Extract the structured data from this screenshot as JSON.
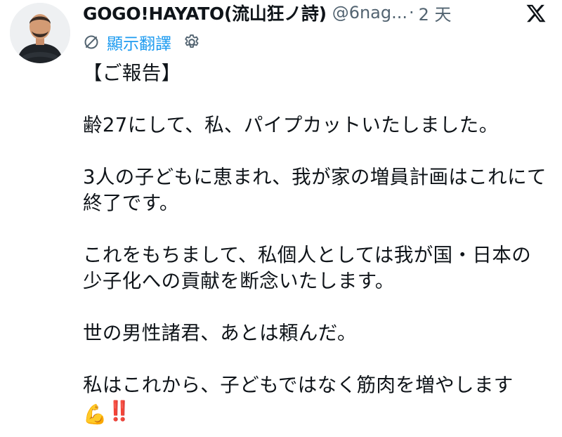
{
  "tweet": {
    "display_name": "GOGO!HAYATO(流山狂ノ詩)",
    "handle": "@6nag...",
    "separator": "·",
    "time": "2 天",
    "translate_label": "顯示翻譯",
    "paragraphs": [
      "【ご報告】",
      "齢27にして、私、パイプカットいたしました。",
      "3人の子どもに恵まれ、我が家の増員計画はこれにて終了です。",
      "これをもちまして、私個人としては我が国・日本の少子化への貢献を断念いたします。",
      "世の男性諸君、あとは頼んだ。",
      "私はこれから、子どもではなく筋肉を増やします"
    ],
    "trailing_emoji": "💪",
    "trailing_marks": "‼️"
  },
  "icons": {
    "logo": "x-logo-icon",
    "translate": "translate-globe-icon",
    "settings": "gear-icon",
    "muscle": "flexed-biceps-icon",
    "exclamation": "double-exclamation-icon"
  },
  "colors": {
    "link": "#1d9bf0",
    "secondary": "#536471",
    "text": "#0f1419",
    "exclamation": "#e0245e"
  }
}
